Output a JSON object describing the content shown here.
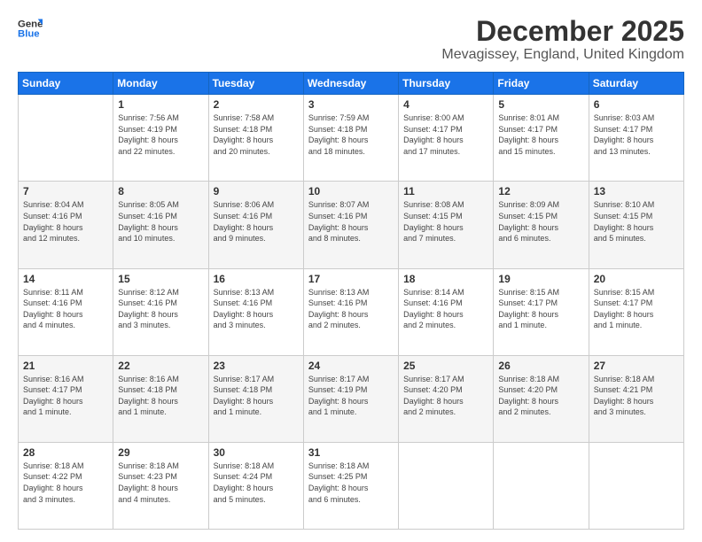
{
  "logo": {
    "line1": "General",
    "line2": "Blue"
  },
  "title": "December 2025",
  "subtitle": "Mevagissey, England, United Kingdom",
  "headers": [
    "Sunday",
    "Monday",
    "Tuesday",
    "Wednesday",
    "Thursday",
    "Friday",
    "Saturday"
  ],
  "weeks": [
    [
      {
        "day": "",
        "info": ""
      },
      {
        "day": "1",
        "info": "Sunrise: 7:56 AM\nSunset: 4:19 PM\nDaylight: 8 hours\nand 22 minutes."
      },
      {
        "day": "2",
        "info": "Sunrise: 7:58 AM\nSunset: 4:18 PM\nDaylight: 8 hours\nand 20 minutes."
      },
      {
        "day": "3",
        "info": "Sunrise: 7:59 AM\nSunset: 4:18 PM\nDaylight: 8 hours\nand 18 minutes."
      },
      {
        "day": "4",
        "info": "Sunrise: 8:00 AM\nSunset: 4:17 PM\nDaylight: 8 hours\nand 17 minutes."
      },
      {
        "day": "5",
        "info": "Sunrise: 8:01 AM\nSunset: 4:17 PM\nDaylight: 8 hours\nand 15 minutes."
      },
      {
        "day": "6",
        "info": "Sunrise: 8:03 AM\nSunset: 4:17 PM\nDaylight: 8 hours\nand 13 minutes."
      }
    ],
    [
      {
        "day": "7",
        "info": "Sunrise: 8:04 AM\nSunset: 4:16 PM\nDaylight: 8 hours\nand 12 minutes."
      },
      {
        "day": "8",
        "info": "Sunrise: 8:05 AM\nSunset: 4:16 PM\nDaylight: 8 hours\nand 10 minutes."
      },
      {
        "day": "9",
        "info": "Sunrise: 8:06 AM\nSunset: 4:16 PM\nDaylight: 8 hours\nand 9 minutes."
      },
      {
        "day": "10",
        "info": "Sunrise: 8:07 AM\nSunset: 4:16 PM\nDaylight: 8 hours\nand 8 minutes."
      },
      {
        "day": "11",
        "info": "Sunrise: 8:08 AM\nSunset: 4:15 PM\nDaylight: 8 hours\nand 7 minutes."
      },
      {
        "day": "12",
        "info": "Sunrise: 8:09 AM\nSunset: 4:15 PM\nDaylight: 8 hours\nand 6 minutes."
      },
      {
        "day": "13",
        "info": "Sunrise: 8:10 AM\nSunset: 4:15 PM\nDaylight: 8 hours\nand 5 minutes."
      }
    ],
    [
      {
        "day": "14",
        "info": "Sunrise: 8:11 AM\nSunset: 4:16 PM\nDaylight: 8 hours\nand 4 minutes."
      },
      {
        "day": "15",
        "info": "Sunrise: 8:12 AM\nSunset: 4:16 PM\nDaylight: 8 hours\nand 3 minutes."
      },
      {
        "day": "16",
        "info": "Sunrise: 8:13 AM\nSunset: 4:16 PM\nDaylight: 8 hours\nand 3 minutes."
      },
      {
        "day": "17",
        "info": "Sunrise: 8:13 AM\nSunset: 4:16 PM\nDaylight: 8 hours\nand 2 minutes."
      },
      {
        "day": "18",
        "info": "Sunrise: 8:14 AM\nSunset: 4:16 PM\nDaylight: 8 hours\nand 2 minutes."
      },
      {
        "day": "19",
        "info": "Sunrise: 8:15 AM\nSunset: 4:17 PM\nDaylight: 8 hours\nand 1 minute."
      },
      {
        "day": "20",
        "info": "Sunrise: 8:15 AM\nSunset: 4:17 PM\nDaylight: 8 hours\nand 1 minute."
      }
    ],
    [
      {
        "day": "21",
        "info": "Sunrise: 8:16 AM\nSunset: 4:17 PM\nDaylight: 8 hours\nand 1 minute."
      },
      {
        "day": "22",
        "info": "Sunrise: 8:16 AM\nSunset: 4:18 PM\nDaylight: 8 hours\nand 1 minute."
      },
      {
        "day": "23",
        "info": "Sunrise: 8:17 AM\nSunset: 4:18 PM\nDaylight: 8 hours\nand 1 minute."
      },
      {
        "day": "24",
        "info": "Sunrise: 8:17 AM\nSunset: 4:19 PM\nDaylight: 8 hours\nand 1 minute."
      },
      {
        "day": "25",
        "info": "Sunrise: 8:17 AM\nSunset: 4:20 PM\nDaylight: 8 hours\nand 2 minutes."
      },
      {
        "day": "26",
        "info": "Sunrise: 8:18 AM\nSunset: 4:20 PM\nDaylight: 8 hours\nand 2 minutes."
      },
      {
        "day": "27",
        "info": "Sunrise: 8:18 AM\nSunset: 4:21 PM\nDaylight: 8 hours\nand 3 minutes."
      }
    ],
    [
      {
        "day": "28",
        "info": "Sunrise: 8:18 AM\nSunset: 4:22 PM\nDaylight: 8 hours\nand 3 minutes."
      },
      {
        "day": "29",
        "info": "Sunrise: 8:18 AM\nSunset: 4:23 PM\nDaylight: 8 hours\nand 4 minutes."
      },
      {
        "day": "30",
        "info": "Sunrise: 8:18 AM\nSunset: 4:24 PM\nDaylight: 8 hours\nand 5 minutes."
      },
      {
        "day": "31",
        "info": "Sunrise: 8:18 AM\nSunset: 4:25 PM\nDaylight: 8 hours\nand 6 minutes."
      },
      {
        "day": "",
        "info": ""
      },
      {
        "day": "",
        "info": ""
      },
      {
        "day": "",
        "info": ""
      }
    ]
  ]
}
